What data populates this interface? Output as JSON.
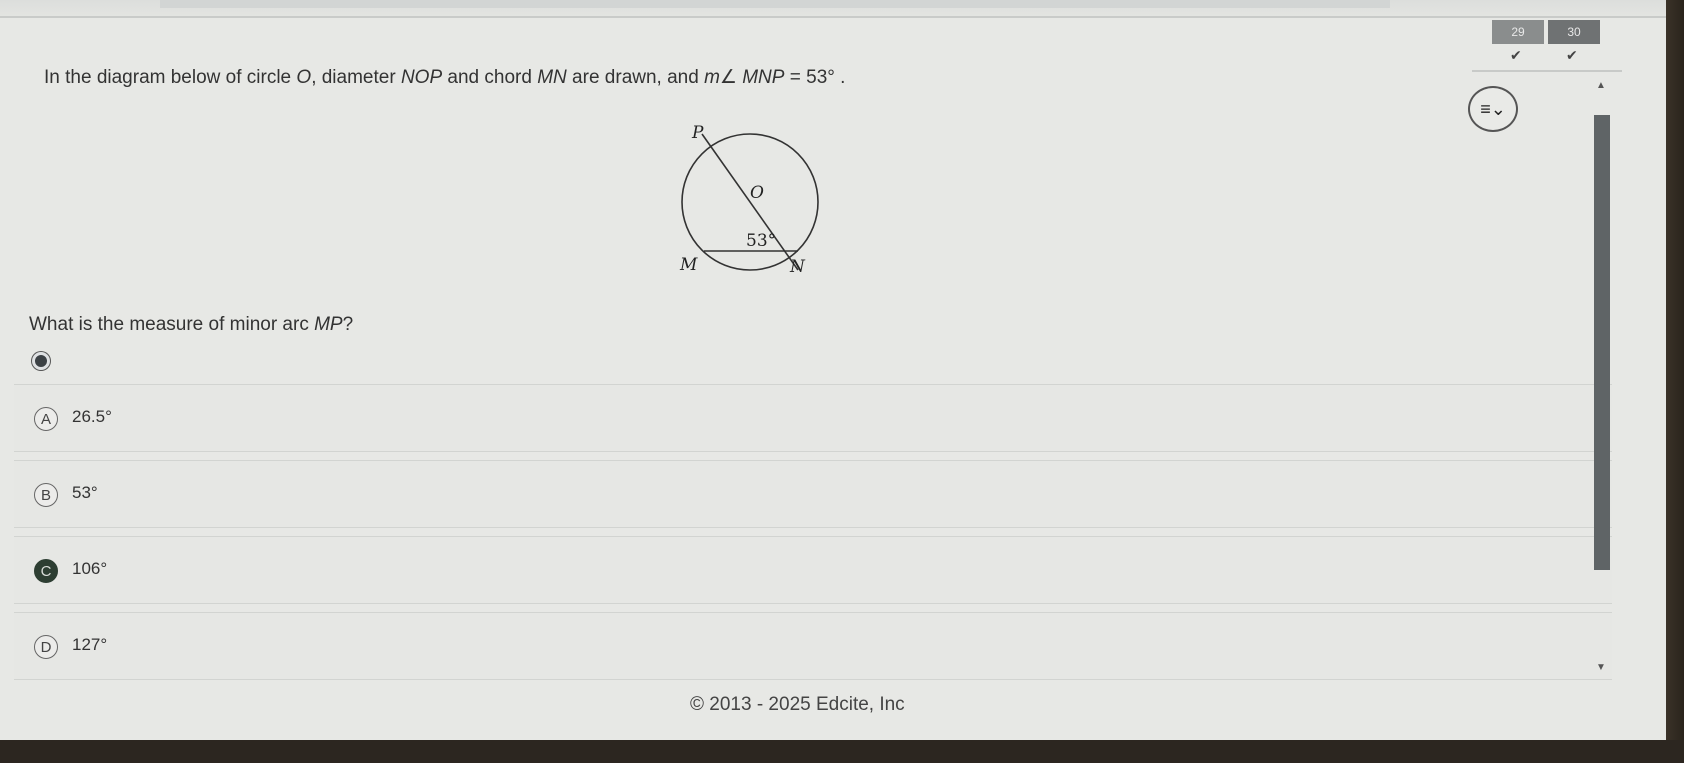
{
  "topbar": {},
  "question_nav": {
    "items": [
      {
        "label": "29",
        "status": "✔"
      },
      {
        "label": "30",
        "status": "✔"
      }
    ]
  },
  "toolbar": {
    "tools_icon": "≡⌄"
  },
  "question": {
    "stem_prefix": "In the diagram below of circle ",
    "circle_name": "O",
    "stem_mid1": ", diameter ",
    "diameter_name": "NOP",
    "stem_mid2": " and chord ",
    "chord_name": "MN",
    "stem_mid3": " are drawn, and ",
    "angle_expr": "m∠ MNP",
    "angle_eq": " = 53° .",
    "diagram": {
      "labels": {
        "P": "P",
        "O": "O",
        "M": "M",
        "N": "N",
        "angle": "53°"
      }
    },
    "prompt_prefix": "What is the measure of minor arc ",
    "prompt_arc": "MP",
    "prompt_suffix": "?"
  },
  "choices": [
    {
      "letter": "A",
      "value": "26.5°"
    },
    {
      "letter": "B",
      "value": "53°"
    },
    {
      "letter": "C",
      "value": "106°",
      "selected": true
    },
    {
      "letter": "D",
      "value": "127°"
    }
  ],
  "footer": {
    "copyright": "© 2013 - 2025 Edcite, Inc"
  }
}
